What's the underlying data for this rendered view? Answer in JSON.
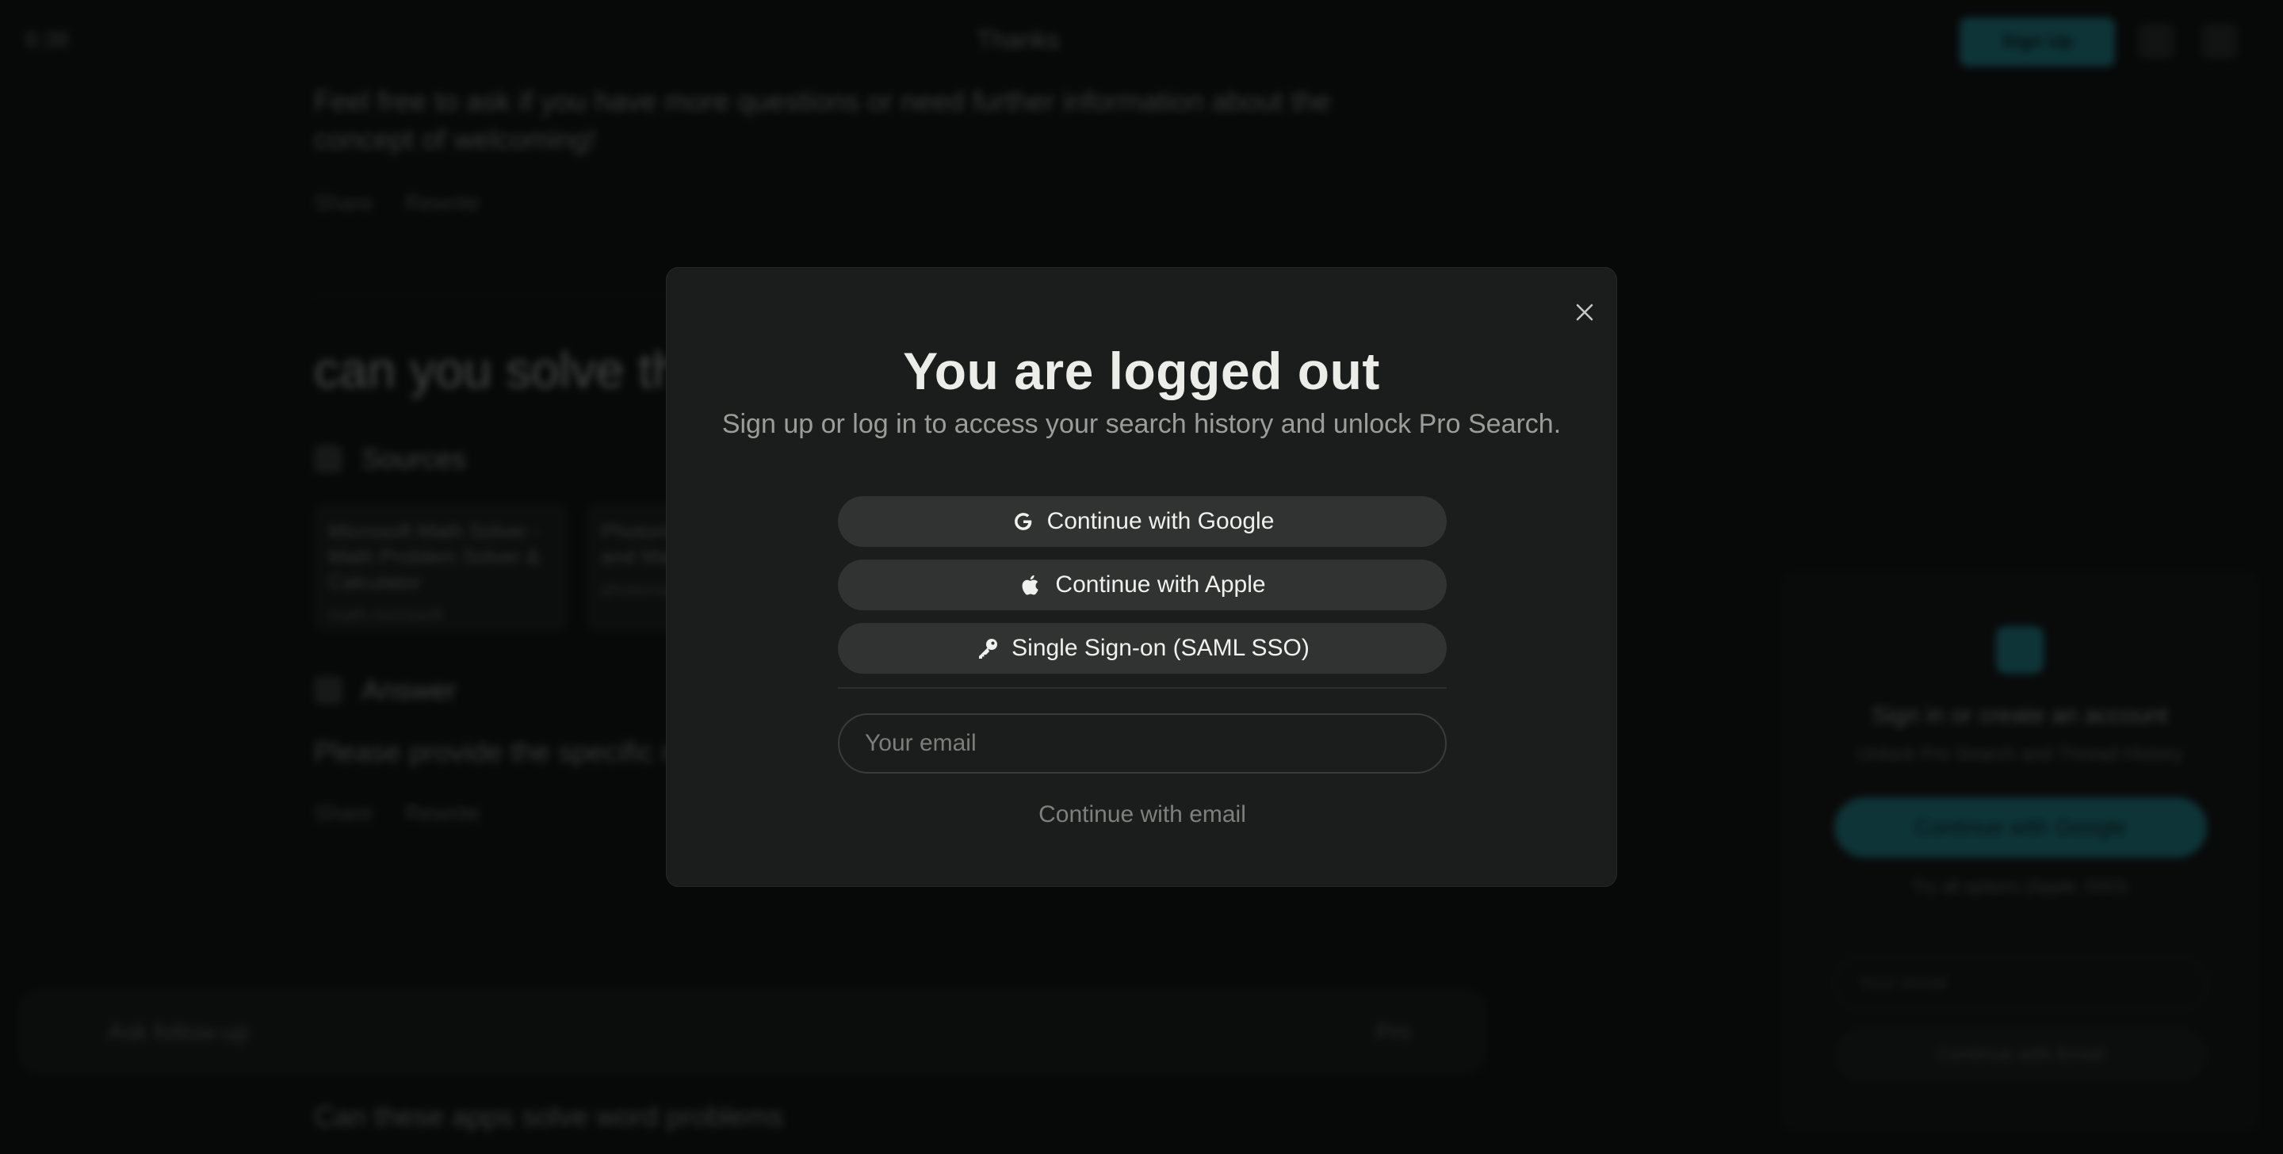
{
  "background": {
    "time": "6:38",
    "thread_title": "Thanks",
    "signup_label": "Sign Up",
    "paragraph": "Feel free to ask if you have more questions or need further information about the concept of welcoming!",
    "share_label": "Share",
    "rewrite_label": "Rewrite",
    "question": "can you solve th",
    "sources_label": "Sources",
    "cards": [
      {
        "text": "Microsoft Math Solver - Math Problem Solver & Calculator",
        "source": "math.microsoft"
      },
      {
        "text": "Photomath - Information and Math Help",
        "source": "photomath"
      }
    ],
    "answer_label": "Answer",
    "answer_text": "Please provide the specific m",
    "follow_placeholder": "Ask follow-up",
    "pro_label": "Pro",
    "related": "Can these apps solve word problems",
    "side_panel": {
      "title": "Sign in or create an account",
      "subtitle": "Unlock Pro Search and Thread History",
      "google": "Continue with Google",
      "email_link": "Try all options (Apple, SSO)",
      "email_placeholder": "Your email",
      "email_btn": "Continue with Email"
    }
  },
  "modal": {
    "title": "You are logged out",
    "subtitle": "Sign up or log in to access your search history and unlock Pro Search.",
    "google_label": "Continue with Google",
    "apple_label": "Continue with Apple",
    "sso_label": "Single Sign-on (SAML SSO)",
    "email_placeholder": "Your email",
    "email_button": "Continue with email"
  },
  "icons": {
    "close": "close-icon",
    "google": "google-icon",
    "apple": "apple-icon",
    "key": "key-icon"
  },
  "colors": {
    "accent": "#1f8a94",
    "modal_bg": "#1b1d1c",
    "button_bg": "#313332"
  }
}
